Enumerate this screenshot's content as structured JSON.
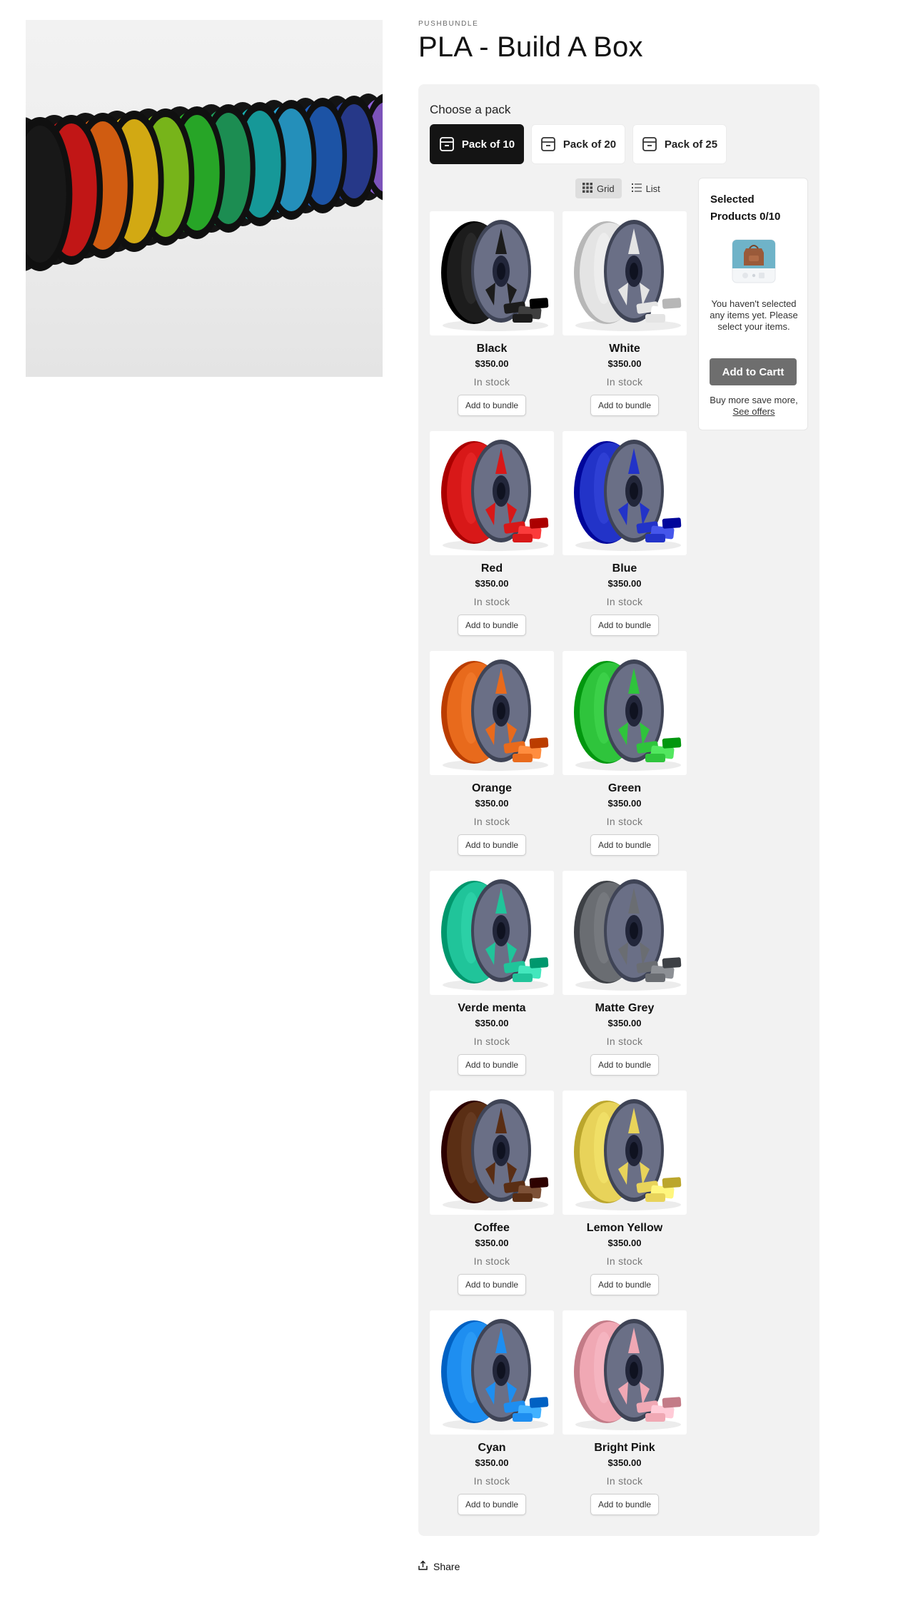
{
  "product": {
    "vendor": "PUSHBUNDLE",
    "title": "PLA - Build A Box",
    "hero_image": "rainbow-filament-spools"
  },
  "bundle": {
    "choose_label": "Choose a pack",
    "packs": [
      {
        "label": "Pack of 10",
        "selected": true,
        "icon": "box-icon"
      },
      {
        "label": "Pack of 20",
        "selected": false,
        "icon": "box-icon"
      },
      {
        "label": "Pack of 25",
        "selected": false,
        "icon": "box-icon"
      }
    ],
    "view": {
      "grid_label": "Grid",
      "list_label": "List",
      "active": "Grid"
    },
    "products": [
      {
        "name": "Black",
        "price": "$350.00",
        "stock": "In stock",
        "button": "Add to bundle",
        "color": "#1c1c1c"
      },
      {
        "name": "White",
        "price": "$350.00",
        "stock": "In stock",
        "button": "Add to bundle",
        "color": "#e4e4e4"
      },
      {
        "name": "Red",
        "price": "$350.00",
        "stock": "In stock",
        "button": "Add to bundle",
        "color": "#d81818"
      },
      {
        "name": "Blue",
        "price": "$350.00",
        "stock": "In stock",
        "button": "Add to bundle",
        "color": "#2233c8"
      },
      {
        "name": "Orange",
        "price": "$350.00",
        "stock": "In stock",
        "button": "Add to bundle",
        "color": "#e86a1c"
      },
      {
        "name": "Green",
        "price": "$350.00",
        "stock": "In stock",
        "button": "Add to bundle",
        "color": "#2fc43c"
      },
      {
        "name": "Verde menta",
        "price": "$350.00",
        "stock": "In stock",
        "button": "Add to bundle",
        "color": "#20c49a"
      },
      {
        "name": "Matte Grey",
        "price": "$350.00",
        "stock": "In stock",
        "button": "Add to bundle",
        "color": "#6a6d72"
      },
      {
        "name": "Coffee",
        "price": "$350.00",
        "stock": "In stock",
        "button": "Add to bundle",
        "color": "#5a2e14"
      },
      {
        "name": "Lemon Yellow",
        "price": "$350.00",
        "stock": "In stock",
        "button": "Add to bundle",
        "color": "#e8d35a"
      },
      {
        "name": "Cyan",
        "price": "$350.00",
        "stock": "In stock",
        "button": "Add to bundle",
        "color": "#1e8ef0"
      },
      {
        "name": "Bright Pink",
        "price": "$350.00",
        "stock": "In stock",
        "button": "Add to bundle",
        "color": "#f0a8b4"
      }
    ],
    "summary": {
      "title": "Selected Products 0/10",
      "empty_message": "You haven't selected any items yet. Please select your items.",
      "add_button": "Add to Cartt",
      "offer_text": "Buy more save more,",
      "offer_link": "See offers"
    }
  },
  "share_label": "Share",
  "colors": {
    "panel_bg": "#f2f2f2",
    "active_pack": "#141414",
    "cart_button": "#6e6e6e"
  }
}
